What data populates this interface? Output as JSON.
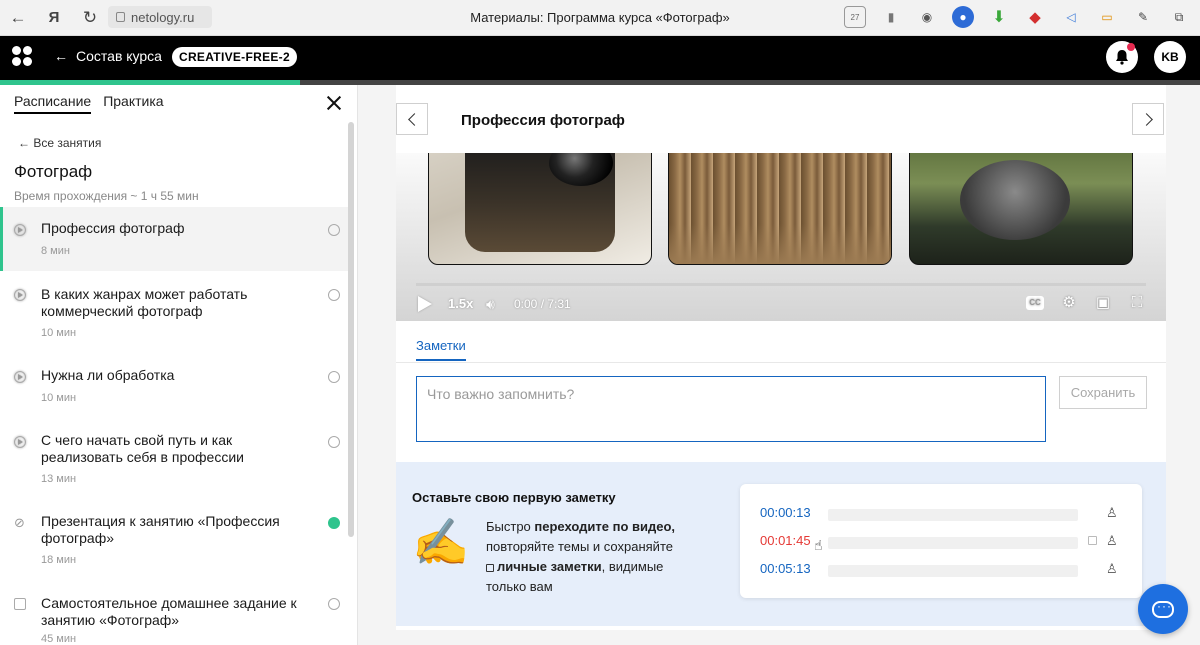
{
  "browser": {
    "back_icon": "back-arrow-icon",
    "yandex_label": "Я",
    "reload_icon": "reload-icon",
    "url": "netology.ru",
    "tab_title": "Материалы: Программа курса «Фотограф»",
    "extension_badge": "27"
  },
  "header": {
    "back_label": "Состав курса",
    "course_code": "CREATIVE-FREE-2",
    "avatar_initials": "KB",
    "progress_fraction": 0.25,
    "accent_color": "#2fc48d"
  },
  "sidebar": {
    "tabs": [
      "Расписание",
      "Практика"
    ],
    "active_tab": "Расписание",
    "all_lessons": "← Все занятия",
    "course_title": "Фотограф",
    "course_time": "Время прохождения ~ 1 ч 55 мин",
    "lessons": [
      {
        "title": "Профессия фотограф",
        "duration": "8 мин",
        "icon": "play-icon",
        "status": "not-started",
        "active": true
      },
      {
        "title": "В каких жанрах может работать коммерческий фотограф",
        "duration": "10 мин",
        "icon": "play-icon",
        "status": "not-started",
        "active": false
      },
      {
        "title": "Нужна ли обработка",
        "duration": "10 мин",
        "icon": "play-icon",
        "status": "not-started",
        "active": false
      },
      {
        "title": "С чего начать свой путь и как реализовать себя в профессии",
        "duration": "13 мин",
        "icon": "play-icon",
        "status": "not-started",
        "active": false
      },
      {
        "title": "Презентация к занятию «Профессия фотограф»",
        "duration": "18 мин",
        "icon": "paperclip-icon",
        "status": "done",
        "active": false
      },
      {
        "title": "Самостоятельное домашнее задание к занятию «Фотограф»",
        "duration": "45 мин",
        "icon": "edit-icon",
        "status": "not-started",
        "active": false
      }
    ]
  },
  "main": {
    "lesson_title": "Профессия фотограф",
    "video": {
      "speed": "1.5x",
      "time": "0:00 / 7:31",
      "cc_label": "CC"
    },
    "notes_tab": "Заметки",
    "note_placeholder": "Что важно запомнить?",
    "save_label": "Сохранить",
    "promo": {
      "title": "Оставьте свою первую заметку",
      "text_1": "Быстро ",
      "text_1_bold": "переходите по видео,",
      "text_2": "повторяйте темы и сохраняйте",
      "text_3_bold": "личные заметки",
      "text_3": ", видимые",
      "text_4": "только вам",
      "timestamps": [
        {
          "time": "00:00:13",
          "color": "#1565c0"
        },
        {
          "time": "00:01:45",
          "color": "#e53935"
        },
        {
          "time": "00:05:13",
          "color": "#1565c0"
        }
      ]
    }
  }
}
